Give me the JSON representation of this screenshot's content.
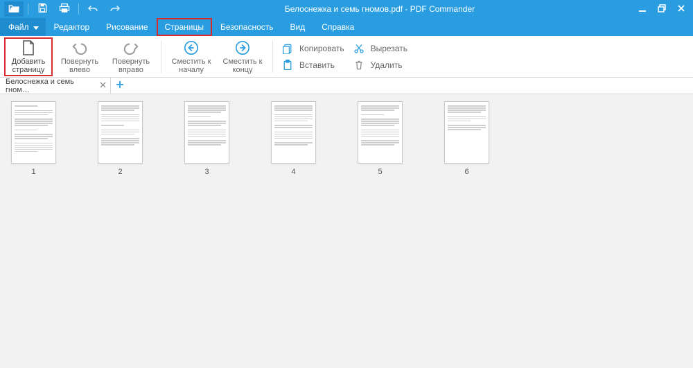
{
  "app": {
    "title": "Белоснежка и семь гномов.pdf - PDF Commander"
  },
  "menu": {
    "file": "Файл",
    "items": [
      "Редактор",
      "Рисование",
      "Страницы",
      "Безопасность",
      "Вид",
      "Справка"
    ],
    "highlighted_index": 2
  },
  "toolbar": {
    "add_page": {
      "l1": "Добавить",
      "l2": "страницу"
    },
    "rotate_left": {
      "l1": "Повернуть",
      "l2": "влево"
    },
    "rotate_right": {
      "l1": "Повернуть",
      "l2": "вправо"
    },
    "move_start": {
      "l1": "Сместить к",
      "l2": "началу"
    },
    "move_end": {
      "l1": "Сместить к",
      "l2": "концу"
    },
    "clipboard": {
      "copy": "Копировать",
      "paste": "Вставить",
      "cut": "Вырезать",
      "delete": "Удалить"
    }
  },
  "tabs": [
    {
      "label": "Белоснежка и семь гном…"
    }
  ],
  "pages": {
    "count": 6,
    "labels": [
      "1",
      "2",
      "3",
      "4",
      "5",
      "6"
    ]
  },
  "colors": {
    "accent": "#299de0",
    "highlight": "#d92b2b"
  }
}
